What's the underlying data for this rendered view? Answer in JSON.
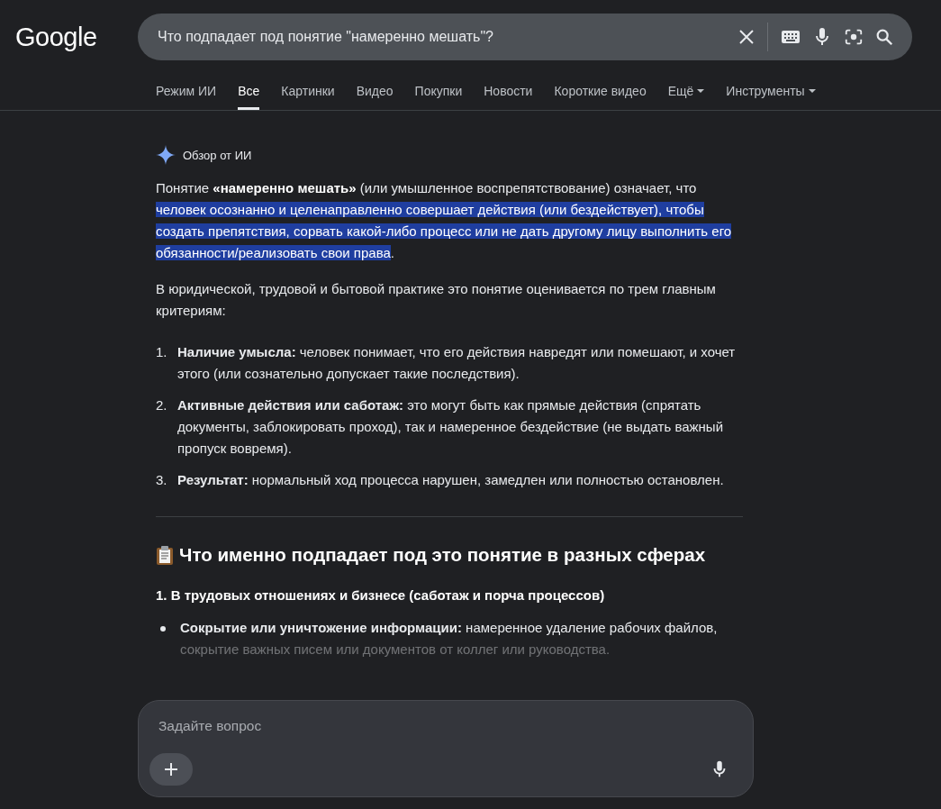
{
  "logo": "Google",
  "search": {
    "value": "Что подпадает под понятие \"намеренно мешать\"?"
  },
  "tabs": [
    {
      "label": "Режим ИИ",
      "selected": false,
      "dropdown": false
    },
    {
      "label": "Все",
      "selected": true,
      "dropdown": false
    },
    {
      "label": "Картинки",
      "selected": false,
      "dropdown": false
    },
    {
      "label": "Видео",
      "selected": false,
      "dropdown": false
    },
    {
      "label": "Покупки",
      "selected": false,
      "dropdown": false
    },
    {
      "label": "Новости",
      "selected": false,
      "dropdown": false
    },
    {
      "label": "Короткие видео",
      "selected": false,
      "dropdown": false
    },
    {
      "label": "Ещё",
      "selected": false,
      "dropdown": true
    },
    {
      "label": "Инструменты",
      "selected": false,
      "dropdown": true
    }
  ],
  "ai_overview": {
    "title": "Обзор от ИИ",
    "intro": [
      {
        "text": "Понятие **«намеренно мешать»** (или умышленное воспрепятствование) означает, что ",
        "highlighted": false
      },
      {
        "text": "человек осознанно и целенаправленно совершает действия (или бездействует), чтобы создать препятствия, сорвать какой-либо процесс или не дать другому лицу выполнить его обязанности/реализовать свои права",
        "highlighted": true
      },
      {
        "text": ".",
        "highlighted": false
      }
    ],
    "paragraph": "В юридической, трудовой и бытовой практике это понятие оценивается по трем главным критериям:",
    "criteria": [
      {
        "number": "1.",
        "text": "**Наличие умысла:** человек понимает, что его действия навредят или помешают, и хочет этого (или сознательно допускает такие последствия)."
      },
      {
        "number": "2.",
        "text": "**Активные действия или саботаж:** это могут быть как прямые действия (спрятать документы, заблокировать проход), так и намеренное бездействие (не выдать важный пропуск вовремя)."
      },
      {
        "number": "3.",
        "text": "**Результат:** нормальный ход процесса нарушен, замедлен или полностью остановлен."
      }
    ],
    "section_heading": "Что именно подпадает под это понятие в разных сферах",
    "subheading": "1. В трудовых отношениях и бизнесе (саботаж и порча процессов)",
    "bullets": [
      {
        "text": "**Сокрытие или уничтожение информации:** намеренное удаление рабочих файлов, сокрытие важных писем или документов от коллег или руководства."
      }
    ]
  },
  "ask_box": {
    "placeholder": "Задайте вопрос"
  }
}
